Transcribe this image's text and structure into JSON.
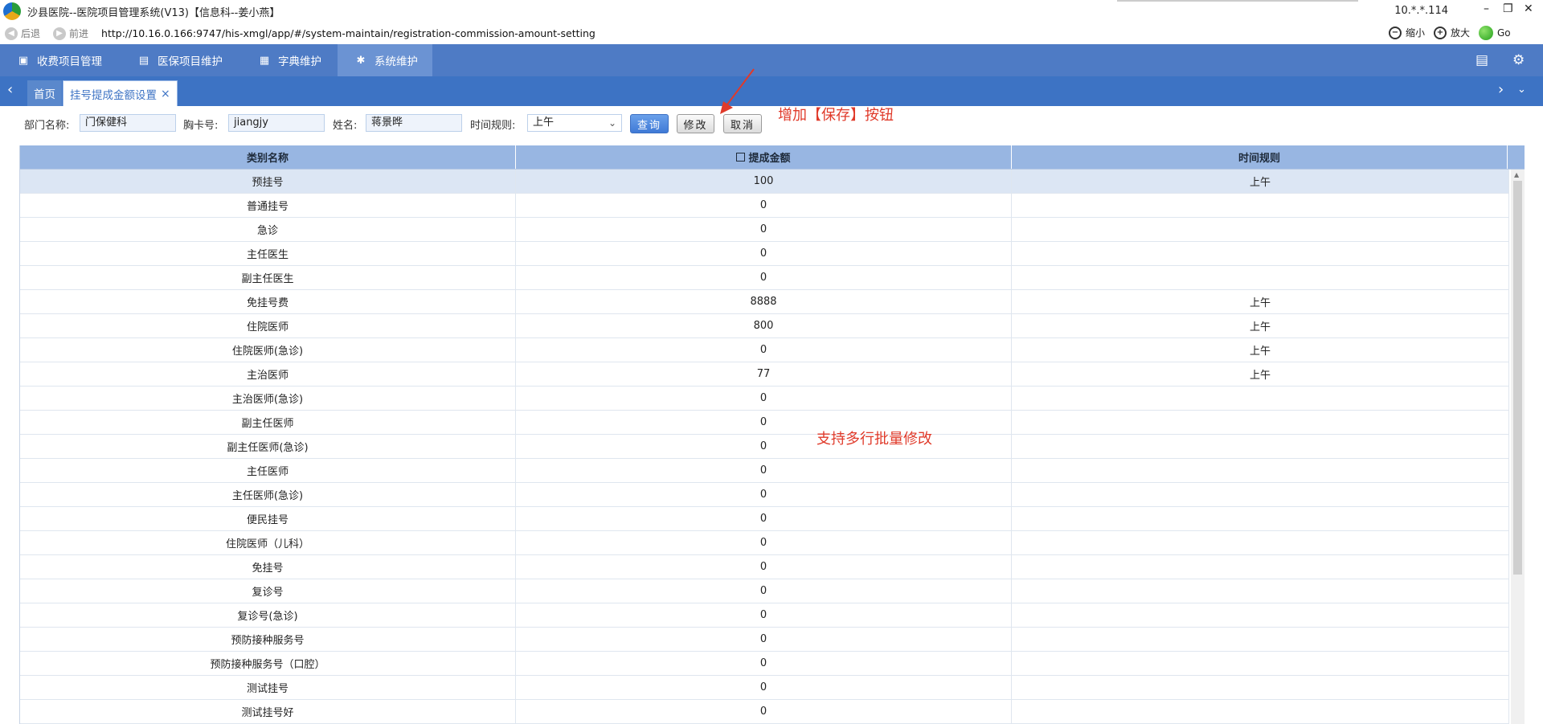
{
  "window": {
    "title": "沙县医院--医院项目管理系统(V13)【信息科--姜小燕】",
    "ip": "10.*.*.114",
    "minimize": "–",
    "restore": "❐",
    "close": "✕"
  },
  "addressbar": {
    "back": "后退",
    "forward": "前进",
    "url": "http://10.16.0.166:9747/his-xmgl/app/#/system-maintain/registration-commission-amount-setting",
    "zoom_out": "缩小",
    "zoom_in": "放大",
    "go": "Go"
  },
  "mainnav": {
    "items": [
      {
        "label": "收费项目管理",
        "icon": "clipboard-icon"
      },
      {
        "label": "医保项目维护",
        "icon": "card-icon"
      },
      {
        "label": "字典维护",
        "icon": "doc-icon"
      },
      {
        "label": "系统维护",
        "icon": "gear-icon"
      }
    ]
  },
  "tabs": {
    "home": "首页",
    "current": "挂号提成金额设置",
    "close": "×"
  },
  "filter": {
    "dept_label": "部门名称:",
    "dept_value": "门保健科",
    "card_label": "胸卡号:",
    "card_value": "jiangjy",
    "name_label": "姓名:",
    "name_value": "蒋景晔",
    "time_label": "时间规则:",
    "time_value": "上午",
    "query": "查询",
    "modify": "修改",
    "cancel": "取消"
  },
  "annotations": {
    "save": "增加【保存】按钮",
    "batch": "支持多行批量修改"
  },
  "table": {
    "headers": [
      "类别名称",
      "提成金额",
      "时间规则"
    ],
    "rows": [
      [
        "预挂号",
        "100",
        "上午"
      ],
      [
        "普通挂号",
        "0",
        ""
      ],
      [
        "急诊",
        "0",
        ""
      ],
      [
        "主任医生",
        "0",
        ""
      ],
      [
        "副主任医生",
        "0",
        ""
      ],
      [
        "免挂号费",
        "8888",
        "上午"
      ],
      [
        "住院医师",
        "800",
        "上午"
      ],
      [
        "住院医师(急诊)",
        "0",
        "上午"
      ],
      [
        "主治医师",
        "77",
        "上午"
      ],
      [
        "主治医师(急诊)",
        "0",
        ""
      ],
      [
        "副主任医师",
        "0",
        ""
      ],
      [
        "副主任医师(急诊)",
        "0",
        ""
      ],
      [
        "主任医师",
        "0",
        ""
      ],
      [
        "主任医师(急诊)",
        "0",
        ""
      ],
      [
        "便民挂号",
        "0",
        ""
      ],
      [
        "住院医师（儿科）",
        "0",
        ""
      ],
      [
        "免挂号",
        "0",
        ""
      ],
      [
        "复诊号",
        "0",
        ""
      ],
      [
        "复诊号(急诊)",
        "0",
        ""
      ],
      [
        "预防接种服务号",
        "0",
        ""
      ],
      [
        "预防接种服务号（口腔）",
        "0",
        ""
      ],
      [
        "测试挂号",
        "0",
        ""
      ],
      [
        "测试挂号好",
        "0",
        ""
      ]
    ]
  }
}
